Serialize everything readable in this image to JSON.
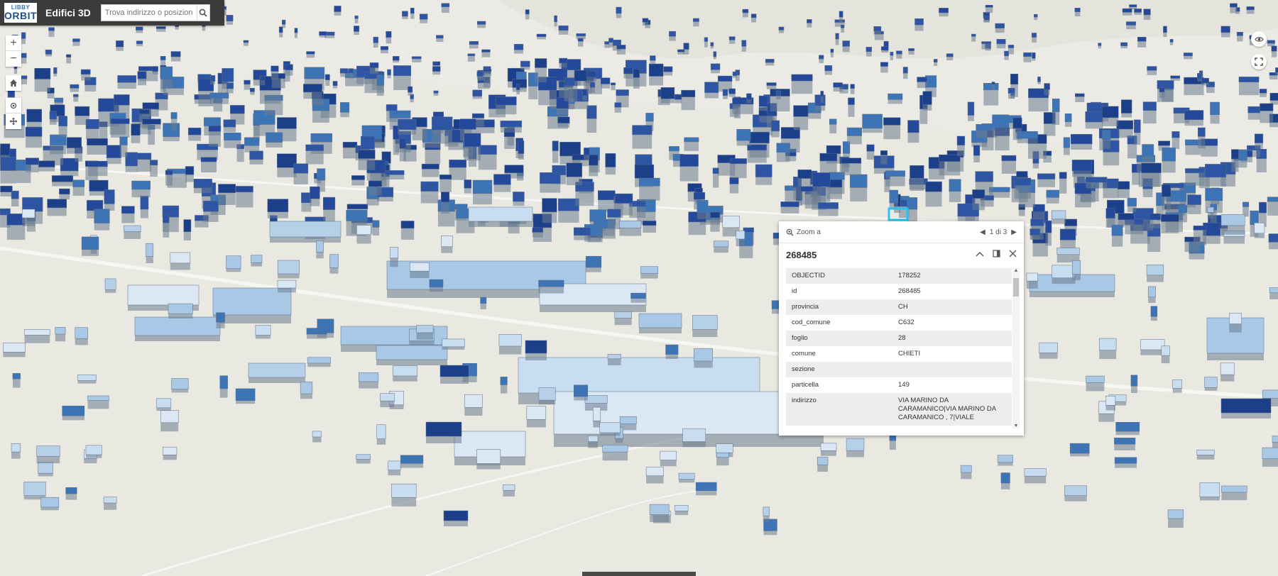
{
  "header": {
    "logo_top": "LIBBY",
    "logo_bottom": "ORBIT",
    "title": "Edifici 3D",
    "search_placeholder": "Trova indirizzo o posizione"
  },
  "widgets": {
    "zoom_in": "+",
    "zoom_out": "−"
  },
  "popup": {
    "zoom_label": "Zoom a",
    "pager": "1 di 3",
    "title": "268485",
    "attributes": [
      {
        "key": "OBJECTID",
        "value": "178252"
      },
      {
        "key": "id",
        "value": "268485"
      },
      {
        "key": "provincia",
        "value": "CH"
      },
      {
        "key": "cod_comune",
        "value": "C632"
      },
      {
        "key": "foglio",
        "value": "28"
      },
      {
        "key": "comune",
        "value": "CHIETI"
      },
      {
        "key": "sezione",
        "value": ""
      },
      {
        "key": "particella",
        "value": "149"
      },
      {
        "key": "indirizzo",
        "value": "VIA MARINO DA CARAMANICO|VIA MARINO DA CARAMANICO , 7|VIALE"
      }
    ]
  },
  "colors": {
    "terrain": "#e9e8e1",
    "building_dark": "#1c3f8a",
    "building_mid": "#3d74b5",
    "building_light": "#c9ddf0",
    "header_bg": "#3c3c3c",
    "selection": "#26c4ee"
  }
}
